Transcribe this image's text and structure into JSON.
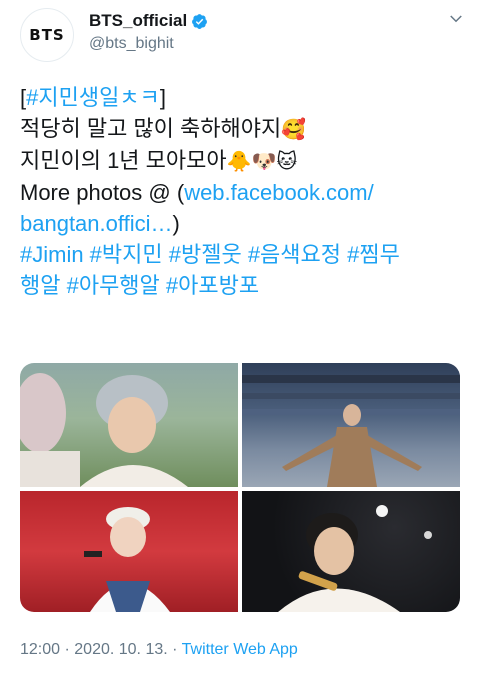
{
  "user": {
    "avatar_text": "BTS",
    "display_name": "BTS_official",
    "handle": "@bts_bighit"
  },
  "tweet": {
    "line1_open": "[",
    "line1_tag": "#지민생일ㅊㅋ",
    "line1_close": "]",
    "line2_text": "적당히 말고 많이 축하해야지",
    "line2_emoji": "🥰",
    "line3_text": "지민이의 1년 모아모아",
    "line3_emojis": "🐥🐶🐱",
    "line4_text": "More photos @ (",
    "line4_link": "web.facebook.com/",
    "line5_link": "bangtan.offici…",
    "line5_close": ")",
    "line6_tags": "#Jimin #박지민 #방젤웃 #음색요정 #찜무",
    "line7_tags": "행알 #아무행알 #아포방포"
  },
  "footer": {
    "time": "12:00",
    "sep1": " · ",
    "date": "2020. 10. 13.",
    "sep2": " · ",
    "source": "Twitter Web App"
  },
  "colors": {
    "link": "#1da1f2",
    "muted": "#657786",
    "text": "#14171a"
  },
  "icons": [
    "verified-badge-icon",
    "chevron-down-icon"
  ]
}
